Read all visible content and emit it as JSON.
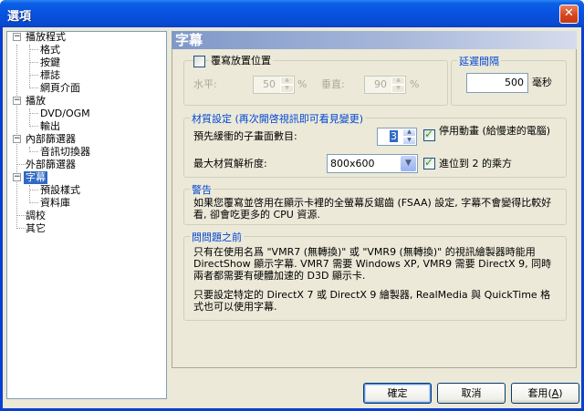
{
  "window": {
    "title": "選項",
    "close_glyph": "✕"
  },
  "tree": {
    "items": [
      {
        "label": "播放程式",
        "level": 0,
        "expander": "−"
      },
      {
        "label": "格式",
        "level": 1
      },
      {
        "label": "按鍵",
        "level": 1
      },
      {
        "label": "標誌",
        "level": 1
      },
      {
        "label": "網頁介面",
        "level": 1
      },
      {
        "label": "播放",
        "level": 0,
        "expander": "−"
      },
      {
        "label": "DVD/OGM",
        "level": 1
      },
      {
        "label": "輸出",
        "level": 1
      },
      {
        "label": "內部篩選器",
        "level": 0,
        "expander": "−"
      },
      {
        "label": "音訊切換器",
        "level": 1
      },
      {
        "label": "外部篩選器",
        "level": 0
      },
      {
        "label": "字幕",
        "level": 0,
        "expander": "−",
        "selected": true
      },
      {
        "label": "預設樣式",
        "level": 1
      },
      {
        "label": "資料庫",
        "level": 1
      },
      {
        "label": "調校",
        "level": 0
      },
      {
        "label": "其它",
        "level": 0
      }
    ]
  },
  "panel": {
    "title": "字幕"
  },
  "override_group": {
    "checkbox_label": "覆寫放置位置",
    "checked": false,
    "horizontal_label": "水平:",
    "horizontal_value": "50",
    "vertical_label": "垂直:",
    "vertical_value": "90",
    "percent": "%"
  },
  "delay_group": {
    "label": "延遲間隔",
    "value": "500",
    "unit": "毫秒"
  },
  "texture_group": {
    "label": "材質設定 (再次開啓視訊即可看見變更)",
    "buffer_label": "預先緩衝的子畫面數目:",
    "buffer_value": "3",
    "disable_animation_label": "停用動畫 (給慢速的電腦)",
    "disable_animation_checked": true,
    "max_res_label": "最大材質解析度:",
    "max_res_value": "800x600",
    "pow2_label": "進位到 2 的乘方",
    "pow2_checked": true
  },
  "warning_group": {
    "label": "警告",
    "text": "如果您覆寫並啓用在顯示卡裡的全螢幕反鋸齒 (FSAA) 設定, 字幕不會變得比較好看, 卻會吃更多的 CPU 資源."
  },
  "faq_group": {
    "label": "問問題之前",
    "text1": "只有在使用名爲 \"VMR7 (無轉換)\" 或 \"VMR9 (無轉換)\" 的視訊繪製器時能用 DirectShow 顯示字幕. VMR7 需要 Windows XP, VMR9 需要 DirectX 9, 同時兩者都需要有硬體加速的 D3D 顯示卡.",
    "text2": "只要設定特定的 DirectX 7 或 DirectX 9 繪製器, RealMedia 與 QuickTime 格式也可以使用字幕."
  },
  "buttons": {
    "ok": "確定",
    "cancel": "取消",
    "apply": "套用",
    "apply_key": "A"
  }
}
